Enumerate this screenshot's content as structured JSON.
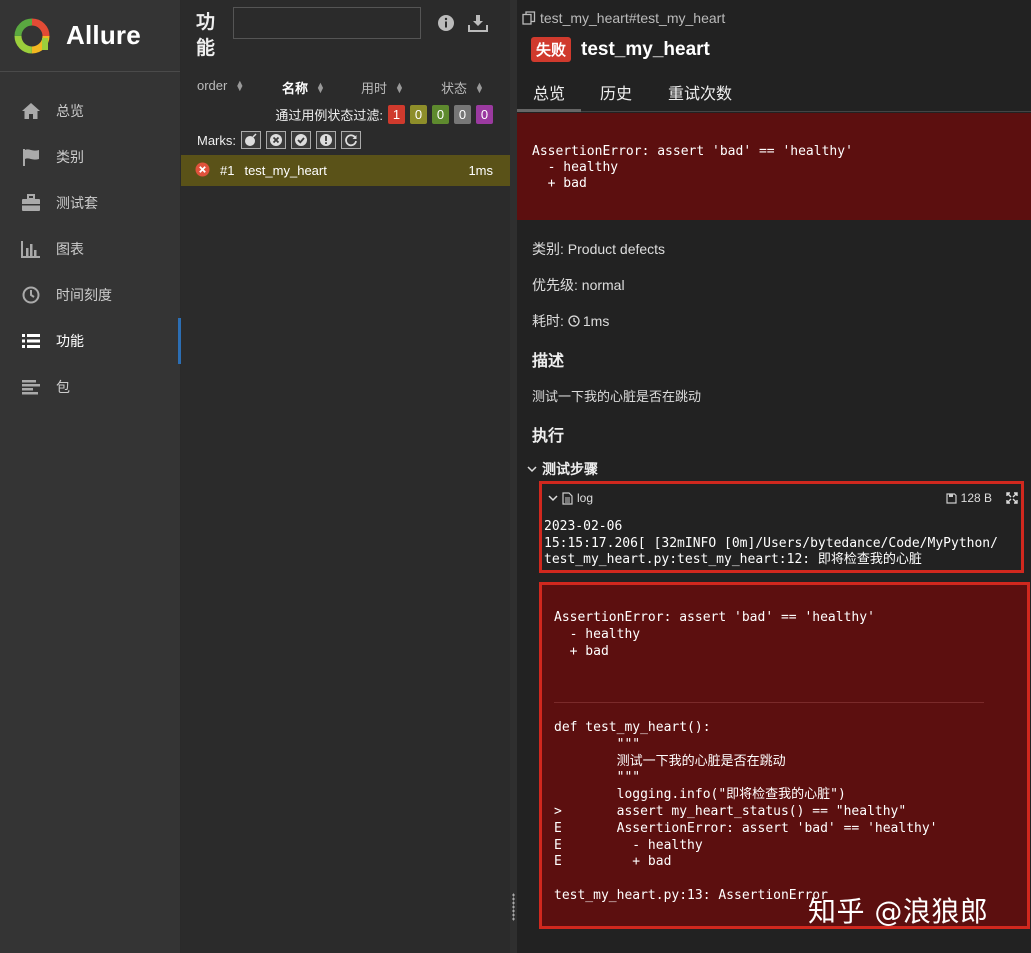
{
  "app": {
    "name": "Allure"
  },
  "sidebar": {
    "items": [
      {
        "label": "总览",
        "icon": "home-icon"
      },
      {
        "label": "类别",
        "icon": "flag-icon"
      },
      {
        "label": "测试套",
        "icon": "briefcase-icon"
      },
      {
        "label": "图表",
        "icon": "bar-chart-icon"
      },
      {
        "label": "时间刻度",
        "icon": "clock-icon"
      },
      {
        "label": "功能",
        "icon": "list-icon",
        "active": true
      },
      {
        "label": "包",
        "icon": "align-left-icon"
      }
    ]
  },
  "tree": {
    "title": "功能",
    "search": {
      "value": "",
      "placeholder": ""
    },
    "columns": [
      "order",
      "名称",
      "用时",
      "状态"
    ],
    "filter": {
      "label": "通过用例状态过滤:",
      "counts": [
        {
          "value": "1",
          "color": "#d03a2d"
        },
        {
          "value": "0",
          "color": "#8e8e2a"
        },
        {
          "value": "0",
          "color": "#5e8a2e"
        },
        {
          "value": "0",
          "color": "#777777"
        },
        {
          "value": "0",
          "color": "#9b3aa0"
        }
      ]
    },
    "marks_label": "Marks:",
    "marks": [
      "flaky-bomb-icon",
      "new-failed-icon",
      "new-passed-icon",
      "new-broken-icon",
      "retries-icon"
    ],
    "rows": [
      {
        "order": "#1",
        "name": "test_my_heart",
        "duration": "1ms",
        "status": "failed"
      }
    ]
  },
  "detail": {
    "breadcrumb": "test_my_heart#test_my_heart",
    "status_label": "失败",
    "test_name": "test_my_heart",
    "tabs": [
      "总览",
      "历史",
      "重试次数"
    ],
    "error_message": "AssertionError: assert 'bad' == 'healthy'\n  - healthy\n  + bad",
    "category": "类别: Product defects",
    "severity": "优先级: normal",
    "duration_label": "耗时:",
    "duration_value": "1ms",
    "description_heading": "描述",
    "description": "测试一下我的心脏是否在跳动",
    "execution_heading": "执行",
    "steps_label": "测试步骤",
    "log": {
      "name": "log",
      "size": "128 B",
      "content": "2023-02-06\n15:15:17.206[ [32mINFO [0m]/Users/bytedance/Code/MyPython/\ntest_my_heart.py:test_my_heart:12: 即将检查我的心脏"
    },
    "trace_message": "AssertionError: assert 'bad' == 'healthy'\n  - healthy\n  + bad",
    "trace_code": "def test_my_heart():\n        \"\"\"\n        测试一下我的心脏是否在跳动\n        \"\"\"\n        logging.info(\"即将检查我的心脏\")\n>       assert my_heart_status() == \"healthy\"\nE       AssertionError: assert 'bad' == 'healthy'\nE         - healthy\nE         + bad\n\ntest_my_heart.py:13: AssertionError"
  },
  "watermark": "知乎 @浪狼郎"
}
